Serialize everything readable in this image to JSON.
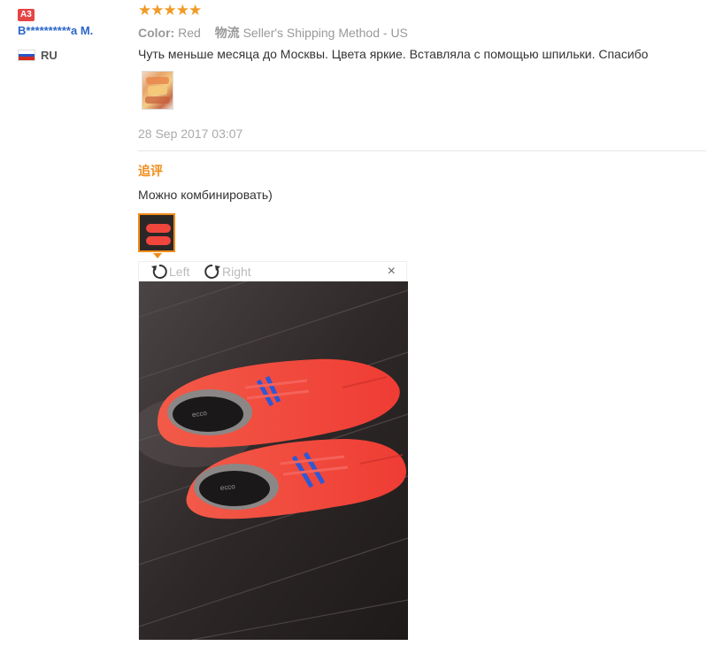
{
  "user": {
    "level_badge": "A3",
    "name": "B**********a M.",
    "country": "RU"
  },
  "review": {
    "stars": "★★★★★",
    "color_label": "Color:",
    "color_value": "Red",
    "shipping_label": "物流",
    "shipping_value": "Seller's Shipping Method - US",
    "text": "Чуть меньше месяца до Москвы. Цвета яркие. Вставляла с помощью шпильки. Спасибо",
    "date": "28 Sep 2017 03:07"
  },
  "followup": {
    "heading": "追评",
    "text": "Можно комбинировать)"
  },
  "viewer": {
    "rotate_left": "Left",
    "rotate_right": "Right",
    "close": "×",
    "shoe_logo": "ecco"
  },
  "colors": {
    "accent_orange": "#f08c1a",
    "star_color": "#f19a27",
    "badge_red": "#e64545",
    "username_blue": "#2a66c9",
    "shoe_red": "#f0463c"
  },
  "icons": {
    "rotate_left": "rotate-left-icon",
    "rotate_right": "rotate-right-icon",
    "close": "close-icon",
    "flag": "russia-flag-icon"
  }
}
